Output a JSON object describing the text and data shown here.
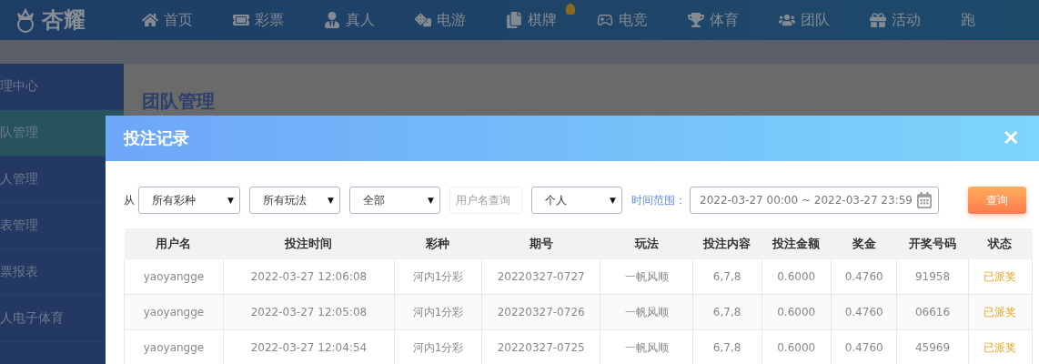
{
  "header": {
    "logo": "杏耀",
    "nav": [
      {
        "label": "首页"
      },
      {
        "label": "彩票"
      },
      {
        "label": "真人"
      },
      {
        "label": "电游"
      },
      {
        "label": "棋牌",
        "hot": true
      },
      {
        "label": "电竞"
      },
      {
        "label": "体育"
      },
      {
        "label": "团队"
      },
      {
        "label": "活动"
      },
      {
        "label": "跑"
      }
    ]
  },
  "sidebar": {
    "items": [
      {
        "label": "理中心",
        "selected": false
      },
      {
        "label": "队管理",
        "selected": true
      },
      {
        "label": "人管理",
        "selected": false
      },
      {
        "label": "表管理",
        "selected": false
      },
      {
        "label": "票报表",
        "selected": false
      },
      {
        "label": "人电子体育",
        "selected": false
      }
    ]
  },
  "page_title": "团队管理",
  "dialog": {
    "title": "投注记录",
    "close": "✕",
    "filters": {
      "from_label": "从",
      "selects": [
        {
          "value": "所有彩种",
          "caret": "▼"
        },
        {
          "value": "所有玩法",
          "caret": "▼"
        },
        {
          "value": "全部",
          "caret": "▼"
        }
      ],
      "username": {
        "placeholder": "用户名查询"
      },
      "scope": {
        "value": "个人",
        "caret": "▼"
      },
      "range_label": "时间范围：",
      "range": "2022-03-27 00:00 ~ 2022-03-27 23:59",
      "query_button": "查询"
    },
    "table": {
      "columns": [
        "用户名",
        "投注时间",
        "彩种",
        "期号",
        "玩法",
        "投注内容",
        "投注金额",
        "奖金",
        "开奖号码",
        "状态"
      ],
      "rows": [
        [
          "yaoyangge",
          "2022-03-27 12:06:08",
          "河内1分彩",
          "20220327-0727",
          "一帆风顺",
          "6,7,8",
          "0.6000",
          "0.4760",
          "91958",
          "已派奖"
        ],
        [
          "yaoyangge",
          "2022-03-27 12:05:08",
          "河内1分彩",
          "20220327-0726",
          "一帆风顺",
          "6,7,8",
          "0.6000",
          "0.4760",
          "06616",
          "已派奖"
        ],
        [
          "yaoyangge",
          "2022-03-27 12:04:54",
          "河内1分彩",
          "20220327-0725",
          "一帆风顺",
          "6,7,8",
          "0.6000",
          "0.4760",
          "45969",
          "已派奖"
        ]
      ]
    }
  }
}
